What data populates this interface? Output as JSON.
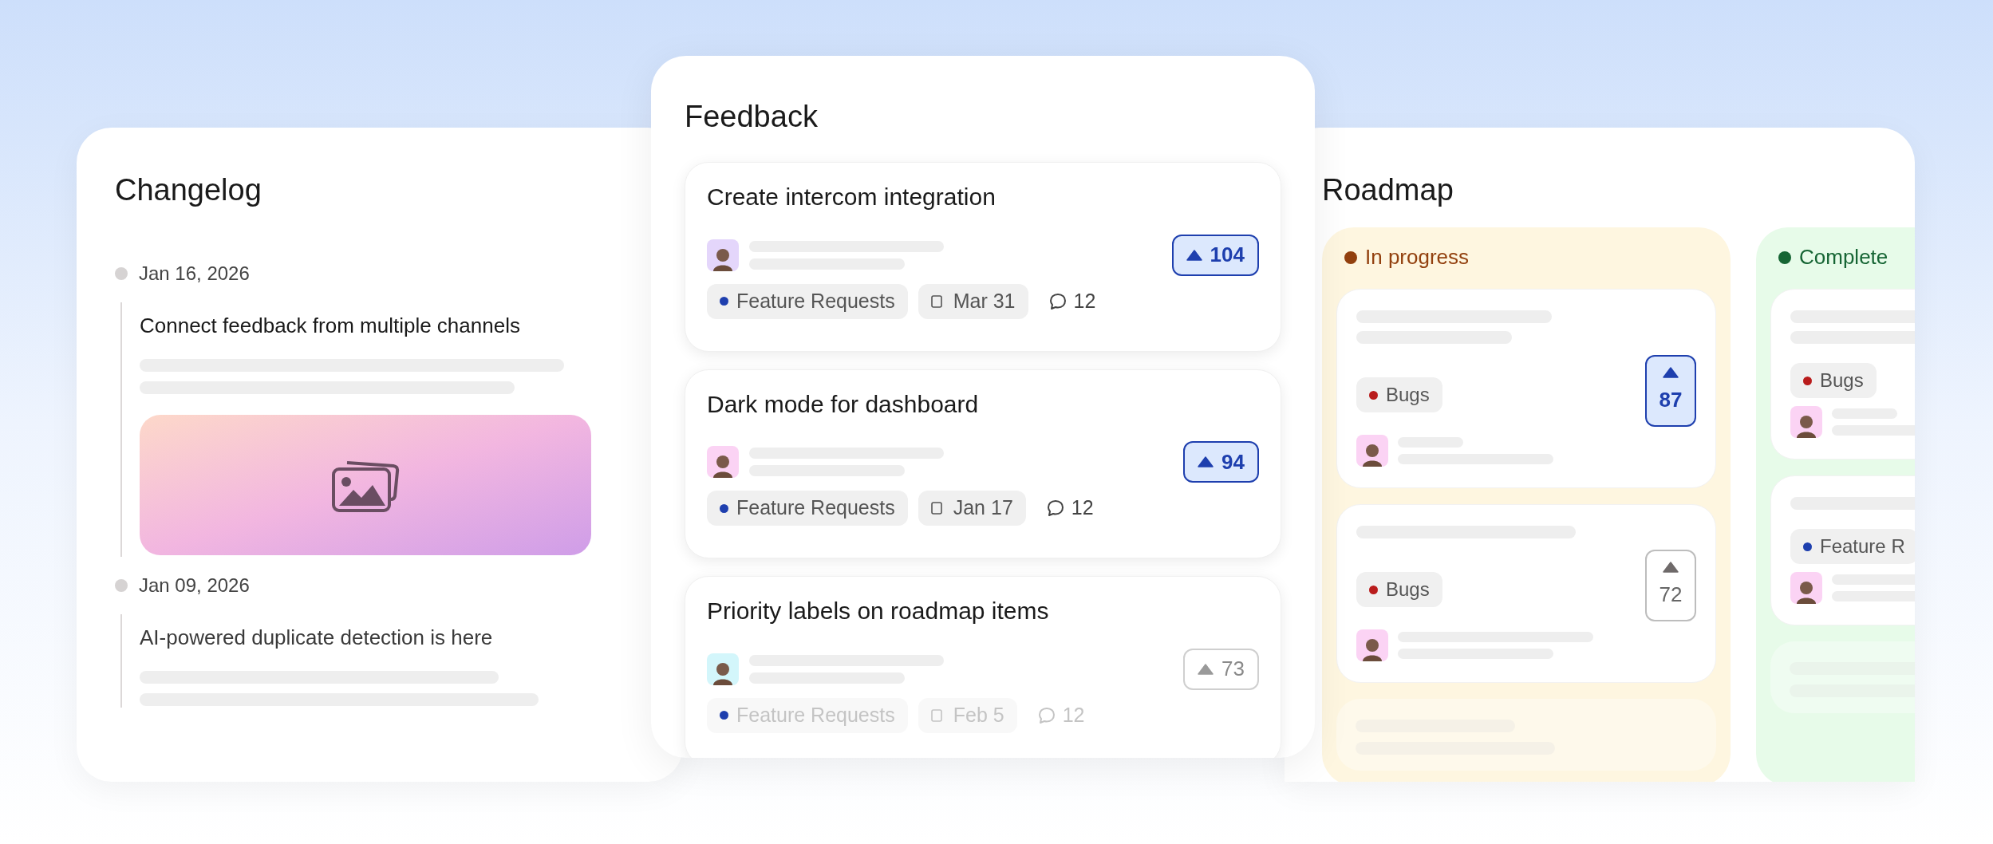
{
  "changelog": {
    "title": "Changelog",
    "entries": [
      {
        "date": "Jan 16, 2026",
        "headline": "Connect feedback from multiple channels",
        "has_image": true
      },
      {
        "date": "Jan 09, 2026",
        "headline": "AI-powered duplicate detection is here",
        "has_image": false
      }
    ]
  },
  "feedback": {
    "title": "Feedback",
    "posts": [
      {
        "title": "Create intercom integration",
        "avatar": {
          "color": "#e4d6fb"
        },
        "votes": "104",
        "voted": true,
        "tag": {
          "label": "Feature Requests",
          "color": "#1e3fae"
        },
        "date": "Mar 31",
        "comments": "12",
        "faded": false
      },
      {
        "title": "Dark mode for dashboard",
        "avatar": {
          "color": "#fbd3f4"
        },
        "votes": "94",
        "voted": true,
        "tag": {
          "label": "Feature Requests",
          "color": "#1e3fae"
        },
        "date": "Jan 17",
        "comments": "12",
        "faded": false
      },
      {
        "title": "Priority labels on roadmap items",
        "avatar": {
          "color": "#d3f6fb"
        },
        "votes": "73",
        "voted": false,
        "tag": {
          "label": "Feature Requests",
          "color": "#1e3fae"
        },
        "date": "Feb 5",
        "comments": "12",
        "faded": true
      }
    ]
  },
  "roadmap": {
    "title": "Roadmap",
    "columns": [
      {
        "label": "In progress",
        "color": "#92400e",
        "cards": [
          {
            "kind": "item",
            "tag": {
              "label": "Bugs",
              "color": "#b91c1c"
            },
            "votes": "87",
            "voted": true,
            "avatar": {
              "color": "#fbd3f4"
            }
          },
          {
            "kind": "item",
            "tag": {
              "label": "Bugs",
              "color": "#b91c1c"
            },
            "votes": "72",
            "voted": false,
            "avatar": {
              "color": "#fbd3f4"
            }
          },
          {
            "kind": "placeholder"
          }
        ]
      },
      {
        "label": "Complete",
        "color": "#166534",
        "cards": [
          {
            "kind": "item",
            "tag": {
              "label": "Bugs",
              "color": "#b91c1c"
            },
            "avatar": {
              "color": "#fbd3f4"
            }
          },
          {
            "kind": "item",
            "tag": {
              "label": "Feature R",
              "color": "#1e3fae"
            },
            "avatar": {
              "color": "#fbd3f4"
            }
          },
          {
            "kind": "placeholder"
          }
        ]
      }
    ]
  }
}
